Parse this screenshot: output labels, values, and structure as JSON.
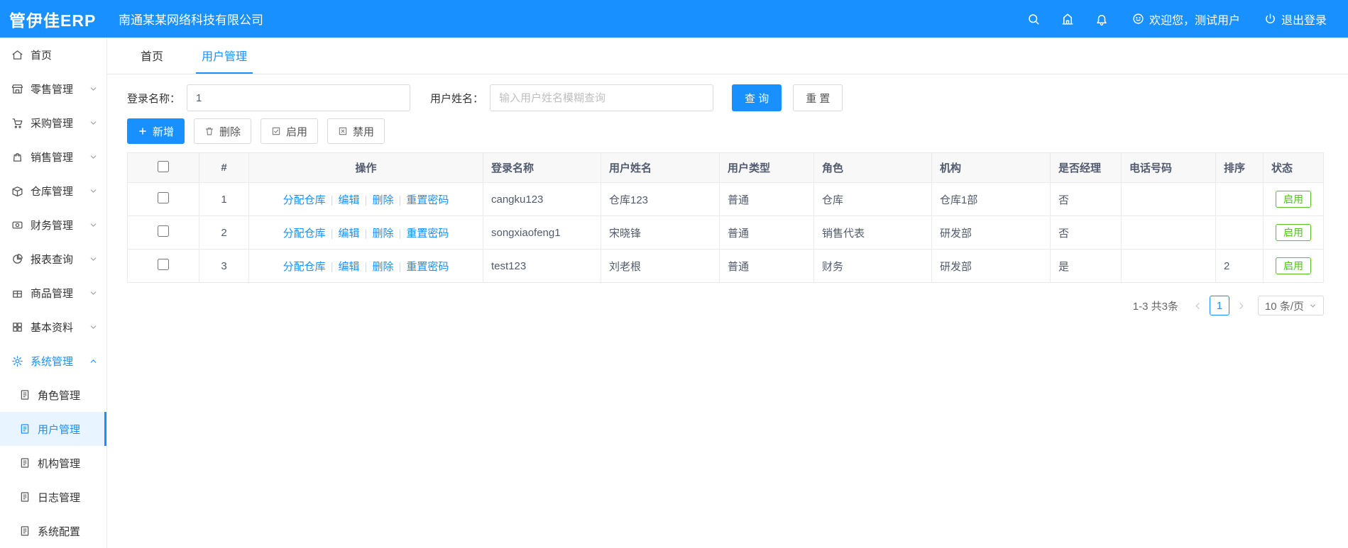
{
  "header": {
    "logo": "管伊佳ERP",
    "company": "南通某某网络科技有限公司",
    "welcome": "欢迎您，测试用户",
    "logout": "退出登录"
  },
  "sidebar": {
    "items": [
      {
        "label": "首页"
      },
      {
        "label": "零售管理"
      },
      {
        "label": "采购管理"
      },
      {
        "label": "销售管理"
      },
      {
        "label": "仓库管理"
      },
      {
        "label": "财务管理"
      },
      {
        "label": "报表查询"
      },
      {
        "label": "商品管理"
      },
      {
        "label": "基本资料"
      },
      {
        "label": "系统管理"
      }
    ],
    "submenu": [
      {
        "label": "角色管理"
      },
      {
        "label": "用户管理"
      },
      {
        "label": "机构管理"
      },
      {
        "label": "日志管理"
      },
      {
        "label": "系统配置"
      }
    ]
  },
  "tabs": [
    {
      "label": "首页"
    },
    {
      "label": "用户管理"
    }
  ],
  "search": {
    "login_label": "登录名称：",
    "login_value": "1",
    "name_label": "用户姓名：",
    "name_placeholder": "输入用户姓名模糊查询",
    "query_button": "查 询",
    "reset_button": "重 置"
  },
  "toolbar": {
    "add": "新增",
    "delete": "删除",
    "enable": "启用",
    "disable": "禁用"
  },
  "table": {
    "headers": {
      "index": "#",
      "actions": "操作",
      "login": "登录名称",
      "name": "用户姓名",
      "type": "用户类型",
      "role": "角色",
      "org": "机构",
      "manager": "是否经理",
      "phone": "电话号码",
      "sort": "排序",
      "status": "状态"
    },
    "action_links": [
      "分配仓库",
      "编辑",
      "删除",
      "重置密码"
    ],
    "link_separator": "|",
    "rows": [
      {
        "index": "1",
        "login": "cangku123",
        "name": "仓库123",
        "type": "普通",
        "role": "仓库",
        "org": "仓库1部",
        "manager": "否",
        "phone": "",
        "sort": "",
        "status": "启用"
      },
      {
        "index": "2",
        "login": "songxiaofeng1",
        "name": "宋晓锋",
        "type": "普通",
        "role": "销售代表",
        "org": "研发部",
        "manager": "否",
        "phone": "",
        "sort": "",
        "status": "启用"
      },
      {
        "index": "3",
        "login": "test123",
        "name": "刘老根",
        "type": "普通",
        "role": "财务",
        "org": "研发部",
        "manager": "是",
        "phone": "",
        "sort": "2",
        "status": "启用"
      }
    ]
  },
  "pagination": {
    "total_text": "1-3 共3条",
    "current_page": "1",
    "page_size": "10 条/页"
  },
  "colors": {
    "primary": "#1890ff",
    "success": "#52c41a"
  }
}
